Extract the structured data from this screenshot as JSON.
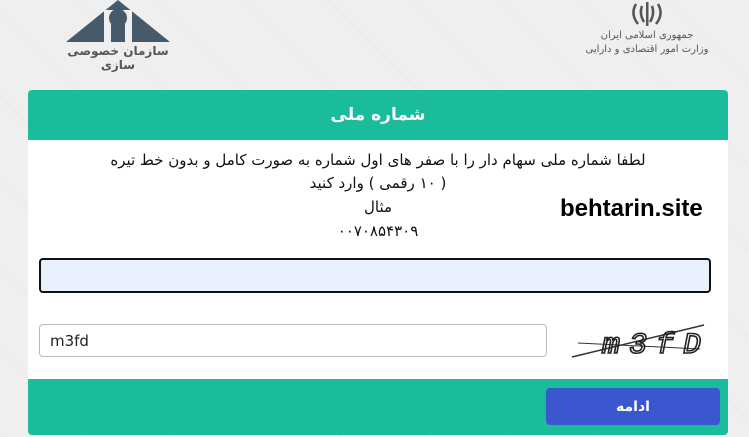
{
  "header": {
    "left_logo_caption": "سازمان خصوصی سازی",
    "right_logo_line1": "جمهوری اسلامی ایران",
    "right_logo_line2": "وزارت امور اقتصادی و دارایی"
  },
  "card": {
    "title": "شماره ملی",
    "instruction_line1": "لطفا شماره ملی سهام دار را با صفر های اول شماره به صورت کامل و بدون خط تیره",
    "instruction_line2": "( ۱۰ رقمی ) وارد کنید",
    "example_label": "مثال",
    "example_value": "۰۰۷۰۸۵۴۳۰۹",
    "watermark": "behtarin.site",
    "national_id": {
      "value": "",
      "placeholder": ""
    },
    "captcha": {
      "value": "m3fd",
      "image_text": "m3fD"
    },
    "continue_label": "ادامه"
  },
  "colors": {
    "card_green": "#1bbc9b",
    "button_blue": "#3b57cf",
    "input_highlight": "#e8f0fe"
  }
}
